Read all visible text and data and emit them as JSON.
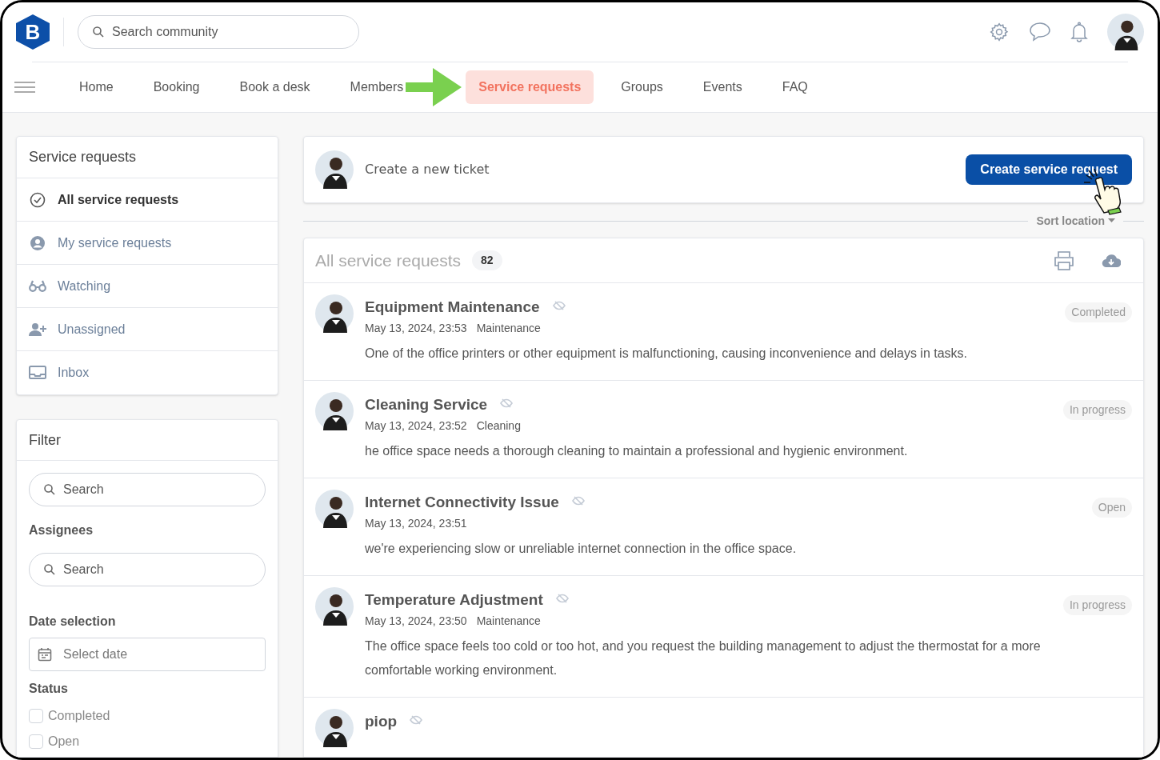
{
  "header": {
    "search": {
      "placeholder": "Search community"
    },
    "logo": "B"
  },
  "nav": [
    {
      "label": "Home",
      "selected": false
    },
    {
      "label": "Booking",
      "selected": false
    },
    {
      "label": "Book a desk",
      "selected": false
    },
    {
      "label": "Members",
      "selected": false
    },
    {
      "label": "Service requests",
      "selected": true
    },
    {
      "label": "Groups",
      "selected": false
    },
    {
      "label": "Events",
      "selected": false
    },
    {
      "label": "FAQ",
      "selected": false
    }
  ],
  "sidebar": {
    "title": "Service requests",
    "items": [
      {
        "label": "All service requests",
        "selected": true
      },
      {
        "label": "My service requests",
        "selected": false
      },
      {
        "label": "Watching",
        "selected": false
      },
      {
        "label": "Unassigned",
        "selected": false
      },
      {
        "label": "Inbox",
        "selected": false
      }
    ]
  },
  "filter": {
    "title": "Filter",
    "search": {
      "placeholder": "Search"
    },
    "assignees": {
      "label": "Assignees",
      "placeholder": "Search"
    },
    "date": {
      "label": "Date selection",
      "placeholder": "Select date"
    },
    "status": {
      "label": "Status",
      "options": [
        {
          "label": "Completed",
          "checked": false
        },
        {
          "label": "Open",
          "checked": false
        }
      ]
    }
  },
  "ticket": {
    "prompt": "Create a new ticket",
    "button": "Create service request"
  },
  "sort": "Sort location",
  "list": {
    "title": "All service requests",
    "count": "82",
    "requests": [
      {
        "title": "Equipment Maintenance",
        "date": "May 13, 2024, 23:53",
        "category": "Maintenance",
        "status": "Completed",
        "description": "One of the office printers or other equipment is malfunctioning, causing inconvenience and delays in tasks."
      },
      {
        "title": "Cleaning Service",
        "date": "May 13, 2024, 23:52",
        "category": "Cleaning",
        "status": "In progress",
        "description": "he office space needs a thorough cleaning to maintain a professional and hygienic environment."
      },
      {
        "title": "Internet Connectivity Issue",
        "date": "May 13, 2024, 23:51",
        "status": "Open",
        "description": "we're experiencing slow or unreliable internet connection in the office space."
      },
      {
        "title": "Temperature Adjustment",
        "date": "May 13, 2024, 23:50",
        "category": "Maintenance",
        "status": "In progress",
        "description": "The office space feels too cold or too hot, and you request the building management to adjust the thermostat for a more comfortable working environment."
      },
      {
        "title": "piop"
      }
    ]
  }
}
